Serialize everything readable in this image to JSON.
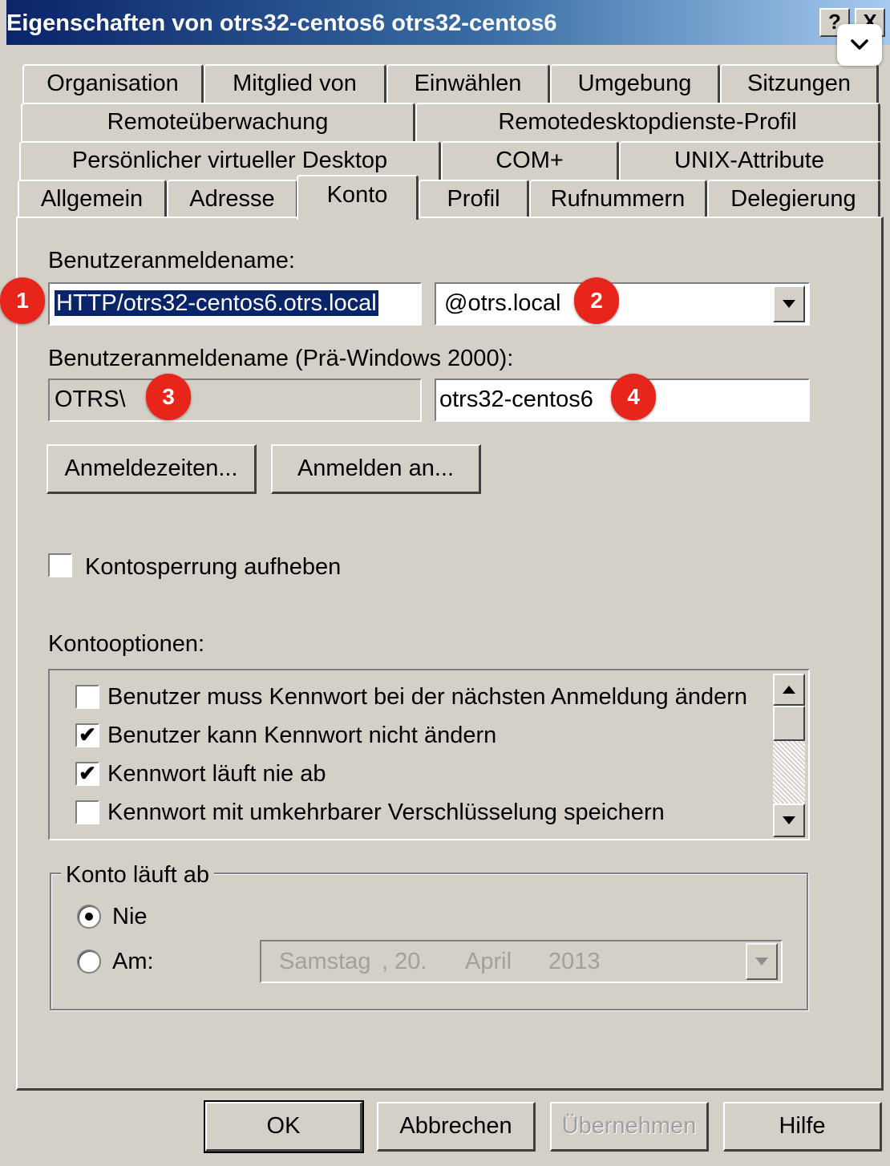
{
  "window": {
    "title": "Eigenschaften von otrs32-centos6 otrs32-centos6",
    "help_button": "?",
    "close_button": "X"
  },
  "tabs": {
    "row1": [
      "Organisation",
      "Mitglied von",
      "Einwählen",
      "Umgebung",
      "Sitzungen"
    ],
    "row2": [
      "Remoteüberwachung",
      "Remotedesktopdienste-Profil"
    ],
    "row3": [
      "Persönlicher virtueller Desktop",
      "COM+",
      "UNIX-Attribute"
    ],
    "row4": [
      "Allgemein",
      "Adresse",
      "Konto",
      "Profil",
      "Rufnummern",
      "Delegierung"
    ],
    "active": "Konto"
  },
  "account": {
    "logon_label": "Benutzeranmeldename:",
    "logon_name": "HTTP/otrs32-centos6.otrs.local",
    "domain_suffix": "@otrs.local",
    "pre2000_label": "Benutzeranmeldename (Prä-Windows 2000):",
    "pre2000_domain": "OTRS\\",
    "pre2000_name": "otrs32-centos6",
    "logon_hours_button": "Anmeldezeiten...",
    "logon_to_button": "Anmelden an...",
    "unlock_label": "Kontosperrung aufheben",
    "unlock_checked": false
  },
  "options": {
    "label": "Kontooptionen:",
    "items": [
      {
        "label": "Benutzer muss Kennwort bei der nächsten Anmeldung ändern",
        "checked": false
      },
      {
        "label": "Benutzer kann Kennwort nicht ändern",
        "checked": true
      },
      {
        "label": "Kennwort läuft nie ab",
        "checked": true
      },
      {
        "label": "Kennwort mit umkehrbarer Verschlüsselung speichern",
        "checked": false
      }
    ]
  },
  "expiry": {
    "group_label": "Konto läuft ab",
    "never_label": "Nie",
    "on_label": "Am:",
    "selected": "Nie",
    "date_weekday": "Samstag",
    "date_day": ", 20.",
    "date_month": "April",
    "date_year": "2013"
  },
  "buttons": {
    "ok": "OK",
    "cancel": "Abbrechen",
    "apply": "Übernehmen",
    "help": "Hilfe"
  },
  "badges": [
    "1",
    "2",
    "3",
    "4"
  ],
  "colors": {
    "badge": "#e8251b",
    "title_bar": "#0a246a",
    "dialog_face": "#d4d0c8"
  }
}
